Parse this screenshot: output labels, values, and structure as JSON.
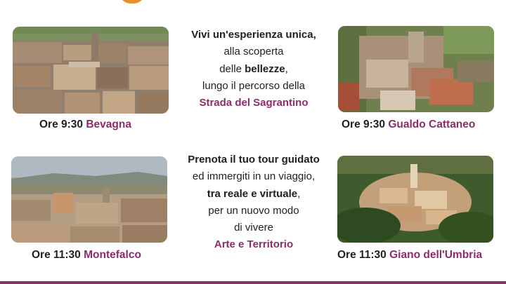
{
  "colors": {
    "accent_plum": "#8a2e6b",
    "accent_orange": "#e8922f",
    "text": "#1f1f1f"
  },
  "tours": [
    {
      "time": "Ore 9:30",
      "place": "Bevagna"
    },
    {
      "time": "Ore 9:30",
      "place": "Gualdo Cattaneo"
    },
    {
      "time": "Ore 11:30",
      "place": "Montefalco"
    },
    {
      "time": "Ore 11:30",
      "place": "Giano dell'Umbria"
    }
  ],
  "intro": {
    "line1": "Vivi un'esperienza unica,",
    "line2": "alla scoperta",
    "line3_before": "delle ",
    "line3_bold": "bellezze",
    "line3_after": ",",
    "line4": "lungo il percorso della",
    "line5": "Strada del Sagrantino"
  },
  "booking": {
    "line1": "Prenota il tuo tour guidato",
    "line2": "ed immergiti in un viaggio,",
    "line3": "tra reale e virtuale",
    "line3_after": ",",
    "line4": "per un nuovo modo",
    "line5": "di vivere",
    "line6": "Arte e Territorio"
  }
}
